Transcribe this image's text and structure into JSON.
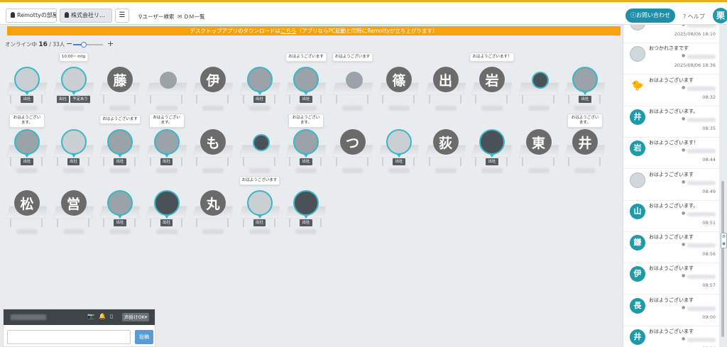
{
  "header": {
    "tabs": [
      {
        "label": "Remottyの部屋",
        "active": false
      },
      {
        "label": "株式会社リ…",
        "active": true
      }
    ],
    "menu_icon": "hamburger-icon",
    "user_search": "ユーザー検索",
    "dm_list": "ＤＭ一覧",
    "contact_label": "お問い合わせ",
    "help_label": "ヘルプ",
    "self_initial": "栗"
  },
  "banner": {
    "text_before": "デスクトップアプリのダウンロードは",
    "link": "こちら",
    "text_after": "（アプリならPC起動と同時にRemottyが立ち上がります）"
  },
  "status": {
    "label": "オンライン中",
    "online": "16",
    "total": "/ 33人",
    "zoom_level": 0.35
  },
  "seats": [
    {
      "type": "photo",
      "tone": "light",
      "badges": [
        "出社"
      ],
      "bubble": ""
    },
    {
      "type": "photo",
      "tone": "light",
      "badges": [
        "出社",
        "予定あり"
      ],
      "bubble": "10:00~ mtg",
      "bubble_wrap": false
    },
    {
      "type": "kanji",
      "char": "藤",
      "badges": [],
      "bubble": ""
    },
    {
      "type": "photo",
      "tone": "none",
      "small": true,
      "badges": [],
      "bubble": ""
    },
    {
      "type": "kanji",
      "char": "伊",
      "badges": [],
      "bubble": ""
    },
    {
      "type": "photo",
      "tone": "",
      "badges": [
        "出社"
      ],
      "bubble": ""
    },
    {
      "type": "photo",
      "tone": "",
      "badges": [
        "出社"
      ],
      "bubble": "おはようございます"
    },
    {
      "type": "photo",
      "tone": "none",
      "small": true,
      "badges": [],
      "bubble": "おはようございます"
    },
    {
      "type": "kanji",
      "char": "篠",
      "badges": [],
      "bubble": ""
    },
    {
      "type": "kanji",
      "char": "出",
      "badges": [],
      "bubble": ""
    },
    {
      "type": "kanji",
      "char": "岩",
      "badges": [],
      "bubble": "おはようございます！"
    },
    {
      "type": "photo",
      "tone": "dark",
      "small": true,
      "badges": [],
      "bubble": ""
    },
    {
      "type": "photo",
      "tone": "",
      "badges": [
        "出社"
      ],
      "bubble": ""
    },
    {
      "type": "photo",
      "tone": "",
      "badges": [
        "出社"
      ],
      "bubble": "おはようございます。",
      "bubble_wrap": true
    },
    {
      "type": "photo",
      "tone": "light",
      "badges": [
        "出社"
      ],
      "bubble": ""
    },
    {
      "type": "photo",
      "tone": "",
      "badges": [
        "出社"
      ],
      "bubble": "おはようございます"
    },
    {
      "type": "photo",
      "tone": "",
      "badges": [
        "出社"
      ],
      "bubble": "おはようございます。",
      "bubble_wrap": true
    },
    {
      "type": "kanji",
      "char": "も",
      "badges": [],
      "bubble": ""
    },
    {
      "type": "photo",
      "tone": "dark",
      "small": true,
      "badges": [],
      "bubble": ""
    },
    {
      "type": "photo",
      "tone": "",
      "badges": [
        "出社"
      ],
      "bubble": "おはようございます。",
      "bubble_wrap": true
    },
    {
      "type": "kanji",
      "char": "つ",
      "badges": [],
      "bubble": ""
    },
    {
      "type": "photo",
      "tone": "light",
      "badges": [
        "出社"
      ],
      "bubble": ""
    },
    {
      "type": "kanji",
      "char": "荻",
      "badges": [],
      "bubble": ""
    },
    {
      "type": "photo",
      "tone": "dark",
      "badges": [
        "出社"
      ],
      "bubble": ""
    },
    {
      "type": "kanji",
      "char": "東",
      "badges": [],
      "bubble": ""
    },
    {
      "type": "kanji",
      "char": "井",
      "badges": [],
      "bubble": "おはようございます。",
      "bubble_wrap": true
    },
    {
      "type": "kanji",
      "char": "松",
      "badges": [],
      "bubble": ""
    },
    {
      "type": "kanji",
      "char": "営",
      "badges": [],
      "bubble": ""
    },
    {
      "type": "photo",
      "tone": "",
      "badges": [
        "出社"
      ],
      "bubble": ""
    },
    {
      "type": "photo",
      "tone": "dark",
      "badges": [
        "出社"
      ],
      "bubble": ""
    },
    {
      "type": "kanji",
      "char": "丸",
      "badges": [],
      "bubble": ""
    },
    {
      "type": "photo",
      "tone": "light",
      "badges": [
        "出社"
      ],
      "bubble": "おはようございます"
    },
    {
      "type": "photo",
      "tone": "dark",
      "badges": [
        "出社"
      ],
      "bubble": ""
    }
  ],
  "compose": {
    "voice_label": "声掛けOK▾",
    "input_value": "",
    "post_label": "投稿"
  },
  "chat": [
    {
      "avatar_type": "photo",
      "initial": "",
      "text": "",
      "time": "2025/08/06 18:10"
    },
    {
      "avatar_type": "photo",
      "initial": "",
      "text": "おつかれさまです",
      "time": "2025/08/06 18:36"
    },
    {
      "avatar_type": "duck",
      "initial": "🐤",
      "text": "おはようございます",
      "time": "08:32"
    },
    {
      "avatar_type": "kanji",
      "initial": "井",
      "text": "おはようございます。",
      "time": "08:35"
    },
    {
      "avatar_type": "kanji",
      "initial": "岩",
      "text": "おはようございます！",
      "time": "08:44"
    },
    {
      "avatar_type": "photo",
      "initial": "",
      "text": "おはようございます",
      "time": "08:49"
    },
    {
      "avatar_type": "kanji",
      "initial": "山",
      "text": "おはようございます。",
      "time": "08:51"
    },
    {
      "avatar_type": "kanji",
      "initial": "鎌",
      "text": "おはようございます",
      "time": "08:56"
    },
    {
      "avatar_type": "kanji",
      "initial": "伊",
      "text": "おはようございます",
      "time": "08:57"
    },
    {
      "avatar_type": "kanji",
      "initial": "長",
      "text": "おはようございます",
      "time": "09:00"
    },
    {
      "avatar_type": "kanji",
      "initial": "井",
      "text": "おはようございます",
      "time": "09:14"
    }
  ]
}
